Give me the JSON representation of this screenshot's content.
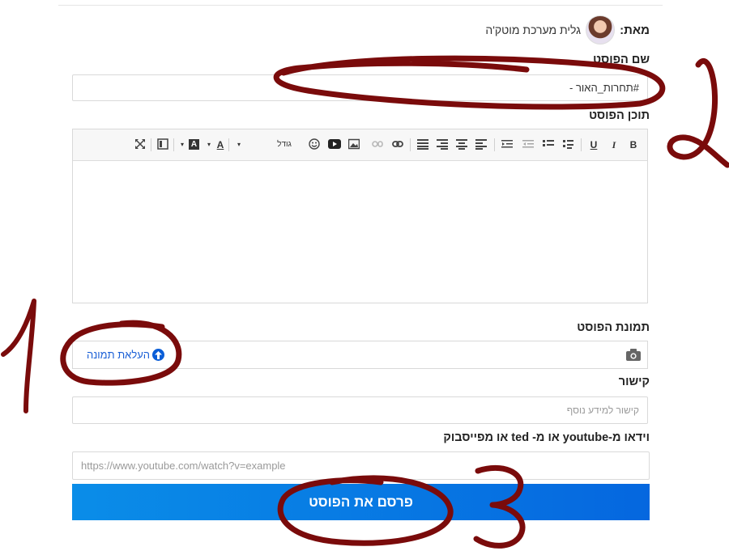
{
  "from": {
    "label": "מאת:",
    "name": "גלית מערכת מוטק'ה"
  },
  "title_field": {
    "label": "שם הפוסט",
    "value": "#תחרות_האור -"
  },
  "content_field": {
    "label": "תוכן הפוסט",
    "toolbar": {
      "bold": "B",
      "italic": "I",
      "underline": "U",
      "size": "גודל",
      "font_color": "A",
      "bg_color": "A"
    }
  },
  "image_field": {
    "label": "תמונת הפוסט",
    "upload_label": "העלאת תמונה"
  },
  "link_field": {
    "label": "קישור",
    "placeholder": "קישור למידע נוסף"
  },
  "video_field": {
    "label": "וידאו מ-youtube או מ- ted או מפייסבוק",
    "placeholder": "https://www.youtube.com/watch?v=example"
  },
  "publish": {
    "label": "פרסם את הפוסט"
  },
  "annotations": {
    "marker_color": "#7a0b0b"
  },
  "colors": {
    "accent": "#0567df",
    "link": "#1a5fd6"
  }
}
